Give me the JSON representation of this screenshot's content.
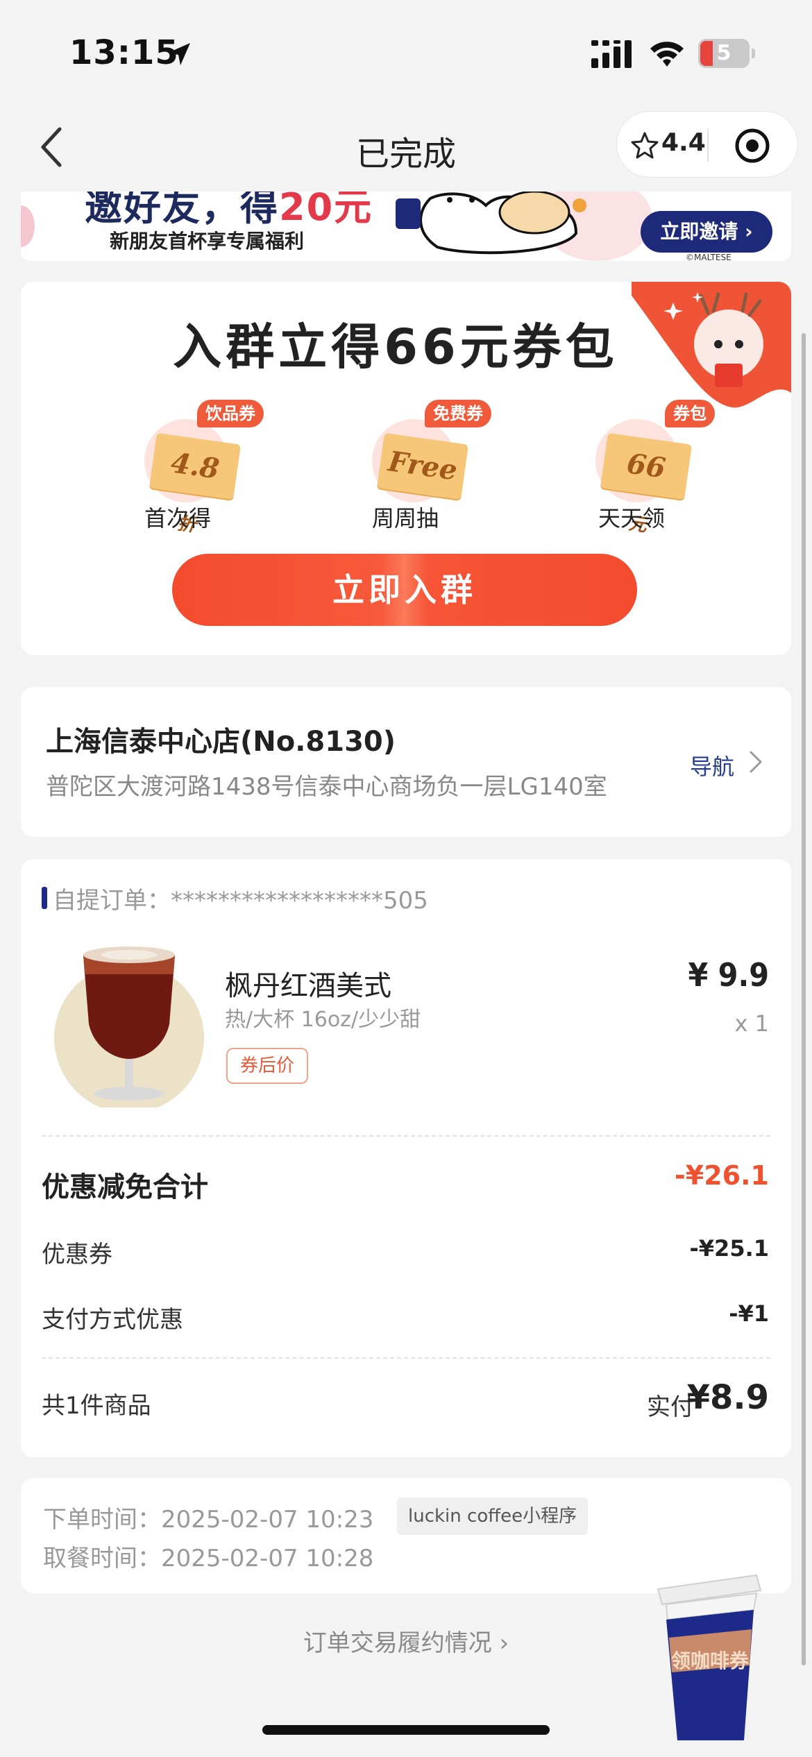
{
  "status_bar": {
    "time": "13:15",
    "battery": "5"
  },
  "nav": {
    "title": "已完成",
    "rating": "4.4"
  },
  "invite_banner": {
    "headline_part1": "邀好友，得",
    "headline_part2": "20元",
    "subtitle": "新朋友首杯享专属福利",
    "button": "立即邀请",
    "copyright": "©MALTESE"
  },
  "group_card": {
    "title": "入群立得66元券包",
    "tickets": [
      {
        "tag": "饮品券",
        "value": "4.8",
        "unit": "折",
        "label": "首次得"
      },
      {
        "tag": "免费券",
        "value": "Free",
        "unit": "",
        "label": "周周抽"
      },
      {
        "tag": "券包",
        "value": "66",
        "unit": "元",
        "label": "天天领"
      }
    ],
    "button": "立即入群"
  },
  "store": {
    "name": "上海信泰中心店(No.8130)",
    "address": "普陀区大渡河路1438号信泰中心商场负一层LG140室",
    "nav_label": "导航"
  },
  "order": {
    "id_label": "自提订单：******************505",
    "product": {
      "name": "枫丹红酒美式",
      "spec": "热/大杯 16oz/少少甜",
      "coupon_tag": "券后价",
      "price": "¥ 9.9",
      "qty": "x 1"
    },
    "discount_title": "优惠减免合计",
    "discount_total": "-¥26.1",
    "rows": [
      {
        "label": "优惠券",
        "value": "-¥25.1"
      },
      {
        "label": "支付方式优惠",
        "value": "-¥1"
      }
    ],
    "count": "共1件商品",
    "paid_label": "实付",
    "paid_value": "¥8.9"
  },
  "times": {
    "order_time": "下单时间：2025-02-07 10:23",
    "pickup_time": "取餐时间：2025-02-07 10:28",
    "source": "luckin coffee小程序"
  },
  "footer": {
    "trace_link": "订单交易履约情况 ›"
  },
  "floating": {
    "cup_label": "领咖啡券"
  },
  "colors": {
    "accent_red": "#f0522f",
    "brand_blue": "#1d2a8a"
  }
}
